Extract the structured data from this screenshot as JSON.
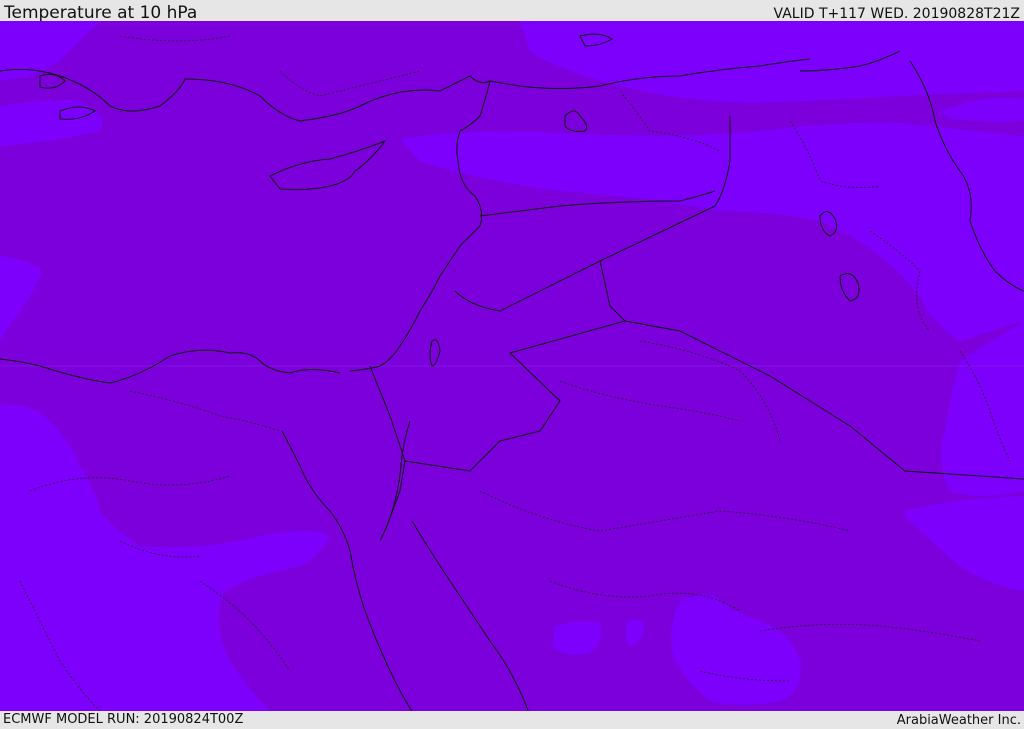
{
  "header": {
    "title": "Temperature at 10 hPa",
    "valid_time": "VALID T+117 WED. 20190828T21Z"
  },
  "footer": {
    "model_run": "ECMWF MODEL RUN: 20190824T00Z",
    "credit": "ArabiaWeather Inc."
  },
  "map": {
    "colors": {
      "dark_purple": "#7b00dc",
      "light_violet": "#7d00fc",
      "coastline": "#111111",
      "border": "#111111"
    }
  }
}
